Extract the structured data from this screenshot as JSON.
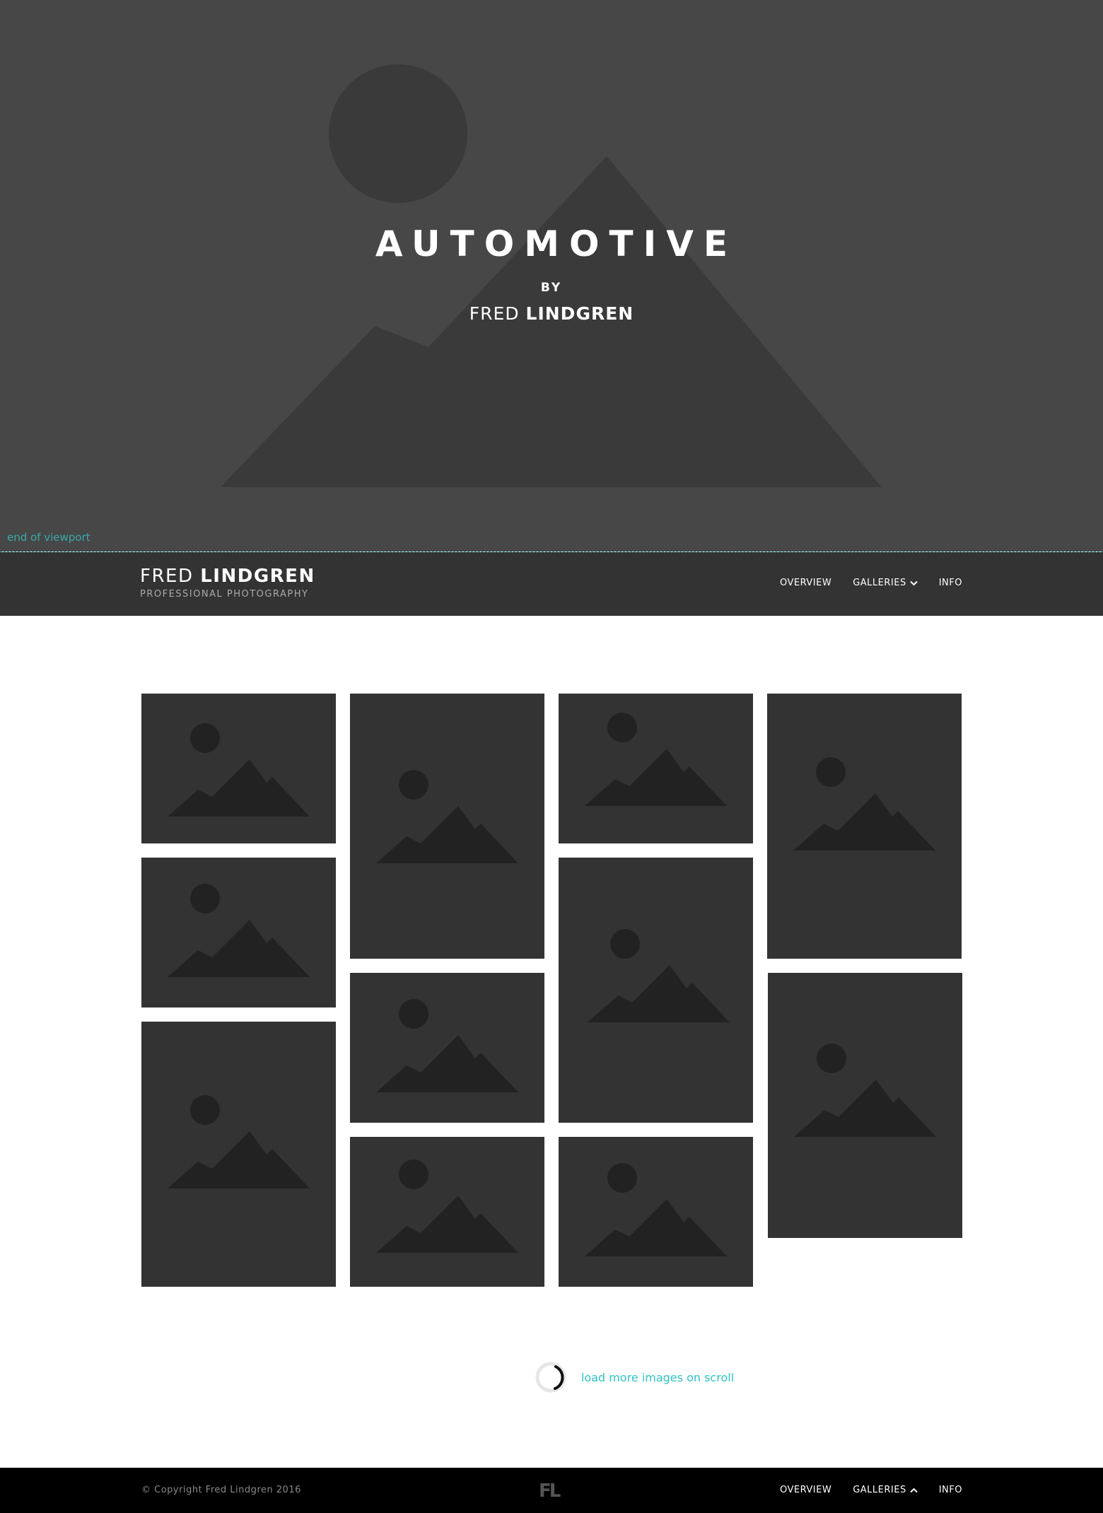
{
  "hero": {
    "title": "AUTOMOTIVE",
    "by": "BY",
    "author_first": "FRED",
    "author_last": "LINDGREN",
    "bg_color": "#474747"
  },
  "viewport_note": "end of viewport",
  "header": {
    "brand_first": "FRED",
    "brand_last": "LINDGREN",
    "tagline": "PROFESSIONAL PHOTOGRAPHY",
    "nav": [
      {
        "label": "OVERVIEW"
      },
      {
        "label": "GALLERIES",
        "icon": "chevron-down-icon"
      },
      {
        "label": "INFO"
      }
    ]
  },
  "gallery": {
    "image_count": 11,
    "placeholder_icon": "image-placeholder-icon"
  },
  "loader": {
    "text": "load more images on scroll",
    "icon": "loading-spinner-icon"
  },
  "footer": {
    "copyright": "© Copyright Fred Lindgren 2016",
    "logo": "FL",
    "nav": [
      {
        "label": "OVERVIEW"
      },
      {
        "label": "GALLERIES",
        "icon": "chevron-up-icon"
      },
      {
        "label": "INFO"
      }
    ]
  },
  "colors": {
    "header_bg": "#333333",
    "footer_bg": "#000000",
    "tile_bg": "#333333",
    "accent": "#2ec4c4"
  }
}
